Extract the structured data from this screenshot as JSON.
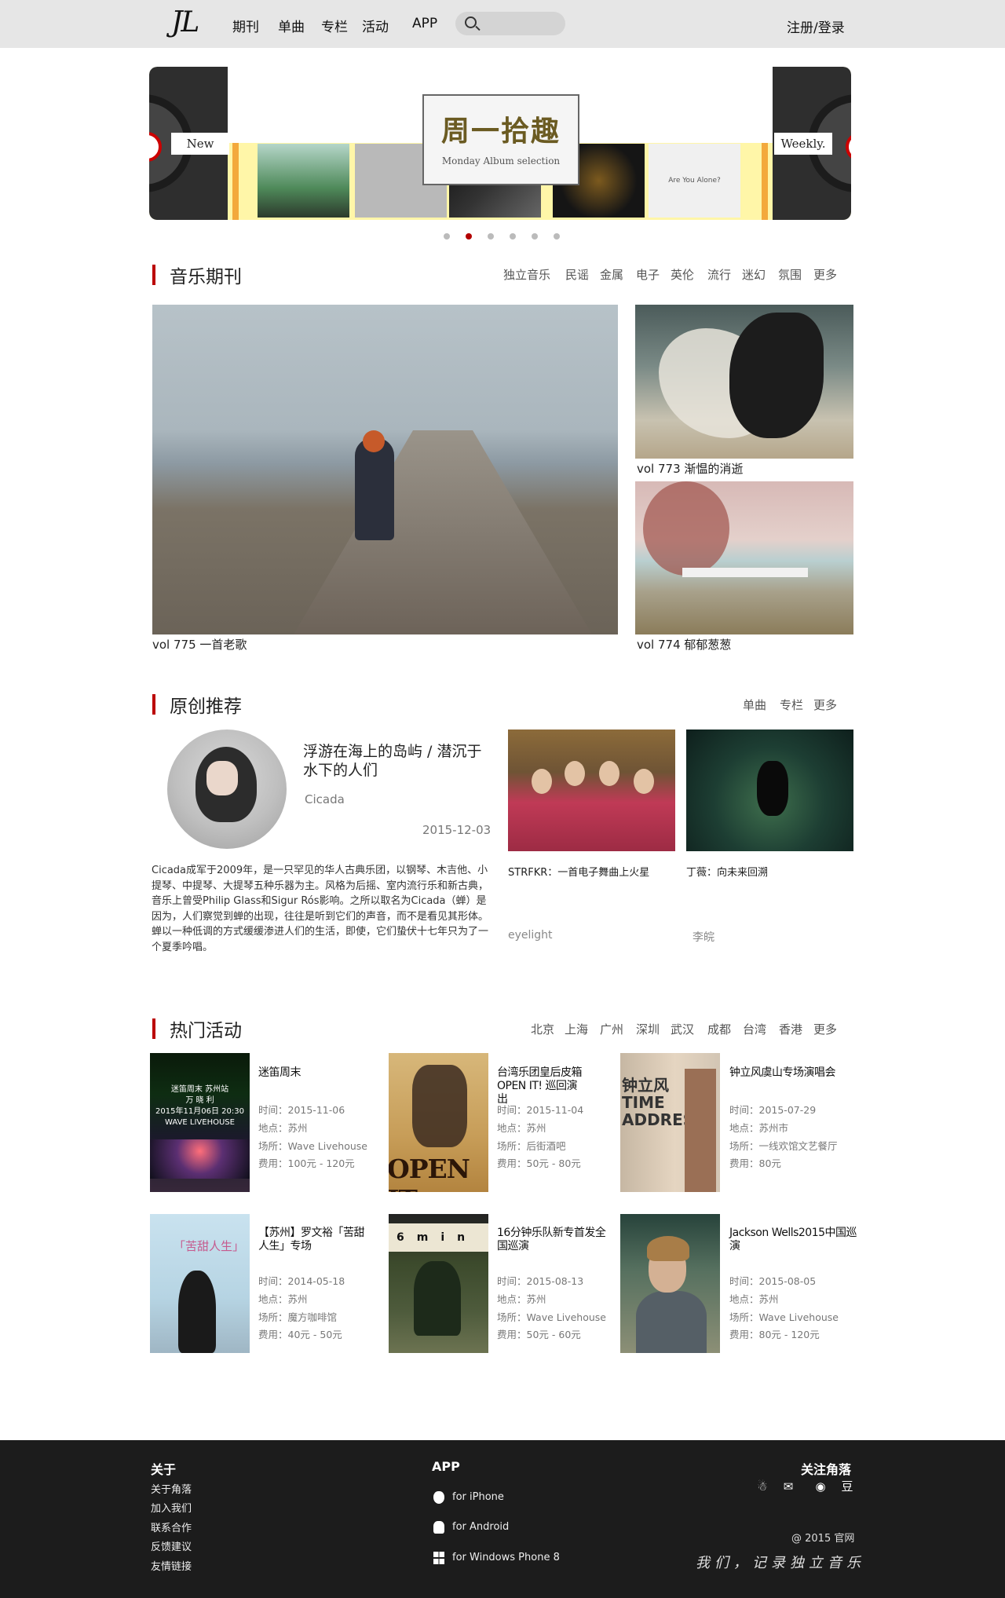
{
  "header": {
    "logo": "JL",
    "nav": [
      "期刊",
      "单曲",
      "专栏",
      "活动",
      "APP"
    ],
    "search_placeholder": "",
    "login": "注册/登录"
  },
  "banner": {
    "left_tag": "New",
    "right_tag": "Weekly.",
    "title": "周一拾趣",
    "subtitle": "Monday Album selection",
    "album_texts": [
      "Are You Alone?"
    ],
    "slide_count": 6,
    "active_slide": 2
  },
  "music_journal": {
    "title": "音乐期刊",
    "tags": [
      "独立音乐",
      "民谣",
      "金属",
      "电子",
      "英伦",
      "流行",
      "迷幻",
      "氛围",
      "更多"
    ],
    "main": {
      "caption": "vol 775   一首老歌"
    },
    "side": [
      {
        "caption": "vol 773  渐愠的消逝"
      },
      {
        "caption": "vol 774  郁郁葱葱"
      }
    ]
  },
  "original": {
    "title": "原创推荐",
    "tabs": [
      "单曲",
      "专栏",
      "更多"
    ],
    "feature": {
      "title": "浮游在海上的岛屿 / 潜沉于水下的人们",
      "artist": "Cicada",
      "date": "2015-12-03",
      "description": "Cicada成军于2009年，是一只罕见的华人古典乐团，以钢琴、木吉他、小提琴、中提琴、大提琴五种乐器为主。风格为后摇、室内流行乐和新古典，音乐上曾受Philip Glass和Sigur Rós影响。之所以取名为Cicada（蝉）是因为，人们察觉到蝉的出现，往往是听到它们的声音，而不是看见其形体。蝉以一种低调的方式缓缓渗进人们的生活，即使，它们蛰伏十七年只为了一个夏季吟唱。"
    },
    "recs": [
      {
        "caption": "STRFKR：一首电子舞曲上火星",
        "author": "eyelight"
      },
      {
        "caption": "丁薇：向未来回溯",
        "author": "李皖"
      }
    ]
  },
  "events": {
    "title": "热门活动",
    "cities": [
      "北京",
      "上海",
      "广州",
      "深圳",
      "武汉",
      "成都",
      "台湾",
      "香港",
      "更多"
    ],
    "items": [
      {
        "title": "迷笛周末",
        "time": "时间：2015-11-06",
        "place": "地点：苏州",
        "venue": "场所：Wave Livehouse",
        "fee": "费用：100元 - 120元",
        "poster_text": "迷笛周末 苏州站\n万 晓 利\n2015年11月06日 20:30\nWAVE LIVEHOUSE"
      },
      {
        "title": "台湾乐团皇后皮箱 OPEN IT! 巡回演出",
        "time": "时间：2015-11-04",
        "place": "地点：苏州",
        "venue": "场所：后街酒吧",
        "fee": "费用：50元 - 80元",
        "poster_text": "OPEN IT"
      },
      {
        "title": "钟立风虞山专场演唱会",
        "time": "时间：2015-07-29",
        "place": "地点：苏州市",
        "venue": "场所：一线欢馆文艺餐厅",
        "fee": "费用：80元",
        "poster_text": "钟立风\nTIME\nADDRESS"
      },
      {
        "title": "【苏州】罗文裕「苦甜人生」专场",
        "time": "时间：2014-05-18",
        "place": "地点：苏州",
        "venue": "场所：魔方咖啡馆",
        "fee": "费用：40元 - 50元",
        "poster_text": "「苦甜人生」"
      },
      {
        "title": "16分钟乐队新专首发全国巡演",
        "time": "时间：2015-08-13",
        "place": "地点：苏州",
        "venue": "场所：Wave Livehouse",
        "fee": "费用：50元 - 60元",
        "poster_text": "6min"
      },
      {
        "title": "Jackson Wells2015中国巡演",
        "time": "时间：2015-08-05",
        "place": "地点：苏州",
        "venue": "场所：Wave Livehouse",
        "fee": "费用：80元 - 120元",
        "poster_text": ""
      }
    ]
  },
  "footer": {
    "about_title": "关于",
    "about_links": [
      "关于角落",
      "加入我们",
      "联系合作",
      "反馈建议",
      "友情链接"
    ],
    "app_title": "APP",
    "app_links": [
      "for iPhone",
      "for Android",
      "for Windows Phone 8"
    ],
    "follow_title": "关注角落",
    "social": [
      {
        "icon": "qq-icon",
        "glyph": "☃"
      },
      {
        "icon": "wechat-icon",
        "glyph": "✉"
      },
      {
        "icon": "weibo-icon",
        "glyph": "◉"
      },
      {
        "icon": "douban-icon",
        "glyph": "豆"
      }
    ],
    "copyright": "@ 2015 官网",
    "slogan": "我们，记录独立音乐"
  },
  "colors": {
    "accent": "#b30000",
    "nav_bg": "#e6e6e6",
    "footer_bg": "#1c1c1c",
    "banner_yellow": "#fff6a8"
  }
}
